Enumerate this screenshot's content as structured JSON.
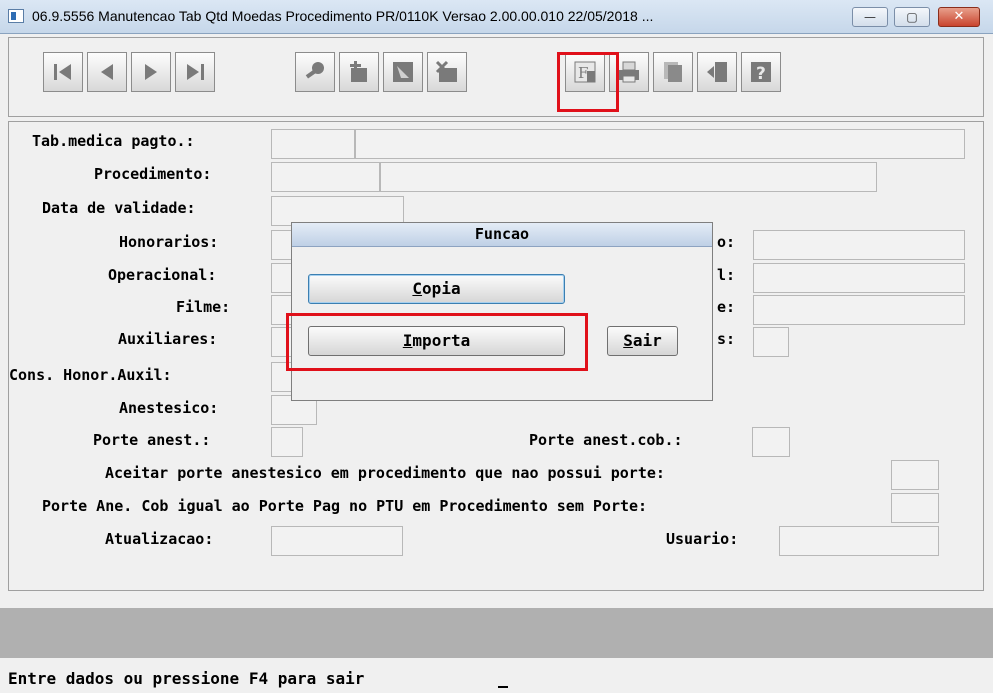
{
  "window": {
    "title": "06.9.5556 Manutencao  Tab Qtd Moedas Procedimento PR/0110K Versao 2.00.00.010 22/05/2018 ...",
    "minimize_glyph": "—",
    "maximize_glyph": "▢",
    "close_glyph": "✕"
  },
  "toolbar": {
    "buttons": [
      {
        "name": "first-record-button",
        "icon": "first-icon"
      },
      {
        "name": "previous-record-button",
        "icon": "previous-icon"
      },
      {
        "name": "next-record-button",
        "icon": "next-icon"
      },
      {
        "name": "last-record-button",
        "icon": "last-icon"
      },
      {
        "name": "search-button",
        "icon": "key-icon"
      },
      {
        "name": "add-button",
        "icon": "add-icon"
      },
      {
        "name": "edit-button",
        "icon": "edit-icon"
      },
      {
        "name": "delete-button",
        "icon": "delete-icon"
      },
      {
        "name": "function-button",
        "icon": "function-icon",
        "highlighted": true
      },
      {
        "name": "print-button",
        "icon": "printer-icon"
      },
      {
        "name": "copy-button",
        "icon": "copy-icon"
      },
      {
        "name": "exit-button",
        "icon": "exit-door-icon"
      },
      {
        "name": "help-button",
        "icon": "help-question-icon"
      }
    ]
  },
  "form": {
    "tab_medica_label": "Tab.medica pagto.:",
    "procedimento_label": "Procedimento:",
    "data_validade_label": "Data de validade:",
    "honorarios_label": "Honorarios:",
    "operacional_label": "Operacional:",
    "filme_label": "Filme:",
    "auxiliares_label": "Auxiliares:",
    "cons_honor_auxil_label": "Cons. Honor.Auxil:",
    "anestesico_label": "Anestesico:",
    "porte_anest_label": "Porte anest.:",
    "porte_anest_cob_label": "Porte anest.cob.:",
    "aceitar_porte_label": "Aceitar porte anestesico em procedimento que nao possui porte:",
    "porte_ane_cob_label": "Porte Ane. Cob igual ao Porte Pag no PTU em Procedimento sem Porte:",
    "atualizacao_label": "Atualizacao:",
    "usuario_label": "Usuario:",
    "right_label_1_tail": "o:",
    "right_label_2_tail": "l:",
    "right_label_3_tail": "e:",
    "right_label_4_tail": "s:"
  },
  "dialog": {
    "title": "Funcao",
    "copia_mnemonic": "C",
    "copia_rest": "opia",
    "importa_mnemonic": "I",
    "importa_rest": "mporta",
    "sair_mnemonic": "S",
    "sair_rest": "air"
  },
  "status_bar": {
    "message": "Entre dados ou pressione F4 para sair"
  },
  "colors": {
    "highlight": "#e0101a",
    "toolbar_icon": "#7a7a7a"
  }
}
